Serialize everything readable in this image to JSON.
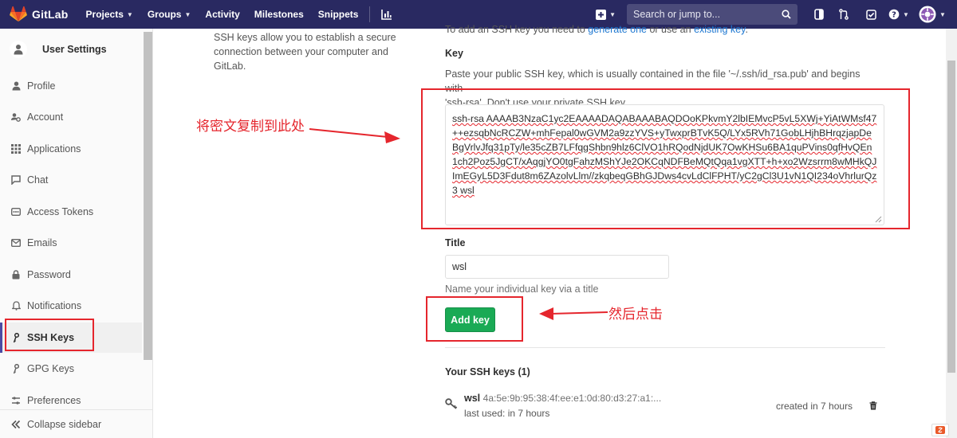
{
  "nav": {
    "brand": "GitLab",
    "items": [
      {
        "label": "Projects",
        "has_caret": true
      },
      {
        "label": "Groups",
        "has_caret": true
      },
      {
        "label": "Activity",
        "has_caret": false
      },
      {
        "label": "Milestones",
        "has_caret": false
      },
      {
        "label": "Snippets",
        "has_caret": false
      }
    ],
    "search_placeholder": "Search or jump to...",
    "icons": [
      "plus-icon",
      "sidebar-toggle-icon",
      "merge-request-icon",
      "todo-check-icon",
      "help-icon",
      "user-avatar-icon"
    ]
  },
  "sidebar": {
    "title": "User Settings",
    "items": [
      {
        "label": "Profile",
        "icon": "profile-icon"
      },
      {
        "label": "Account",
        "icon": "account-icon"
      },
      {
        "label": "Applications",
        "icon": "applications-icon"
      },
      {
        "label": "Chat",
        "icon": "chat-icon"
      },
      {
        "label": "Access Tokens",
        "icon": "token-icon"
      },
      {
        "label": "Emails",
        "icon": "email-icon"
      },
      {
        "label": "Password",
        "icon": "lock-icon"
      },
      {
        "label": "Notifications",
        "icon": "bell-icon"
      },
      {
        "label": "SSH Keys",
        "icon": "key-icon",
        "active": true
      },
      {
        "label": "GPG Keys",
        "icon": "key-icon"
      },
      {
        "label": "Preferences",
        "icon": "preferences-icon"
      }
    ],
    "collapse_label": "Collapse sidebar"
  },
  "main": {
    "intro": "SSH keys allow you to establish a secure connection between your computer and GitLab.",
    "top_cut": {
      "prefix": "To add an SSH key you need to ",
      "link1": "generate one",
      "middle": " or use an ",
      "link2": "existing key",
      "suffix": "."
    },
    "key_label": "Key",
    "key_help_line1": "Paste your public SSH key, which is usually contained in the file '~/.ssh/id_rsa.pub' and begins with",
    "key_help_line2": "'ssh-rsa'. Don't use your private SSH key.",
    "key_value": "ssh-rsa AAAAB3NzaC1yc2EAAAADAQABAAABAQDOoKPkvmY2lbIEMvcP5vL5XWj+YiAtWMsf47++ezsqbNcRCZW+mhFepal0wGVM2a9zzYVS+yTwxprBTvK5Q/LYx5RVh71GobLHjhBHrqzjapDeBgVrlvJfq31pTy/le35cZB7LFfqgShbn9hlz6ClVO1hRQodNjdUK7OwKHSu6BA1quPVins0qfHvQEn1ch2Poz5JgCT/xAqgjYO0tgFahzMShYJe2OKCqNDFBeMQtQqa1vgXTT+h+xo2Wzsrrm8wMHkQJImEGyL5D3Fdut8m6ZAzolvLlm//zkqbeqGBhGJDws4cvLdClFPHT/yC2gCl3U1vN1QI234oVhrlurQz3 wsl",
    "title_label": "Title",
    "title_value": "wsl",
    "title_help": "Name your individual key via a title",
    "add_button": "Add key",
    "keys_heading": "Your SSH keys (1)",
    "keys": [
      {
        "name": "wsl",
        "fingerprint": "4a:5e:9b:95:38:4f:ee:e1:0d:80:d3:27:a1:...",
        "last_used": "last used: in 7 hours",
        "created": "created in 7 hours"
      }
    ]
  },
  "annotations": {
    "paste_here": "将密文复制到此处",
    "then_click": "然后点击",
    "color": "#e5262d"
  },
  "colors": {
    "nav_bg": "#292961",
    "accent": "#4b4ba3",
    "button_green": "#1aaa55",
    "link": "#1f78d1"
  }
}
